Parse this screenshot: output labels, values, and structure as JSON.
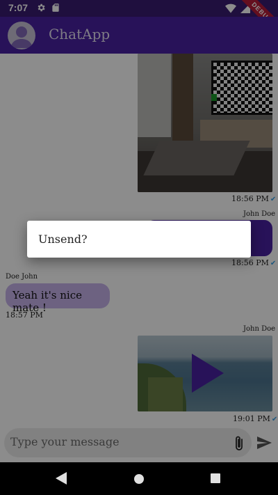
{
  "status_bar": {
    "time": "7:07",
    "debug_banner": "DEBUG"
  },
  "app_bar": {
    "title": "ChatApp"
  },
  "messages": [
    {
      "type": "image",
      "time": "18:56 PM"
    },
    {
      "type": "text_out",
      "sender": "John Doe",
      "time": "18:56 PM"
    },
    {
      "type": "text_in",
      "sender": "Doe John",
      "text": "Yeah it's nice mate !",
      "time": "18:57 PM"
    },
    {
      "type": "video",
      "sender": "John Doe",
      "time": "19:01 PM"
    }
  ],
  "input": {
    "placeholder": "Type your message"
  },
  "dialog": {
    "text": "Unsend?"
  },
  "colors": {
    "primary": "#4a22a3",
    "bubble_in": "#c6b3ec",
    "tick": "#3aa0e6"
  }
}
